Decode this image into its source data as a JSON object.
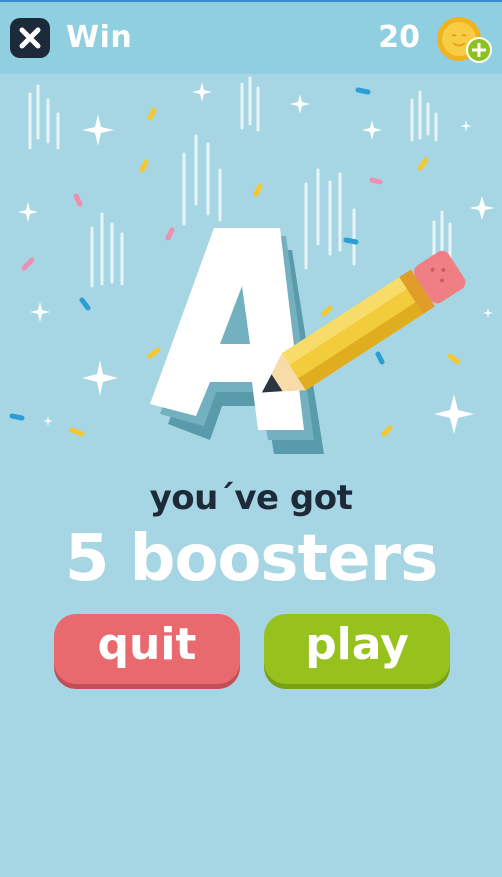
{
  "header": {
    "title": "Win",
    "coins": "20"
  },
  "result": {
    "subtitle": "you´ve got",
    "headline": "5 boosters",
    "letter": "A"
  },
  "actions": {
    "quit_label": "quit",
    "play_label": "play"
  },
  "colors": {
    "background": "#a6d6e3",
    "topbar": "#8fcfe0",
    "quit": "#e8696e",
    "play": "#97c21e",
    "dark_text": "#1d2a3a",
    "coin": "#f5c531"
  },
  "icons": {
    "close": "close-icon",
    "coin": "coin-icon",
    "add": "plus-icon",
    "pencil": "pencil-icon"
  }
}
